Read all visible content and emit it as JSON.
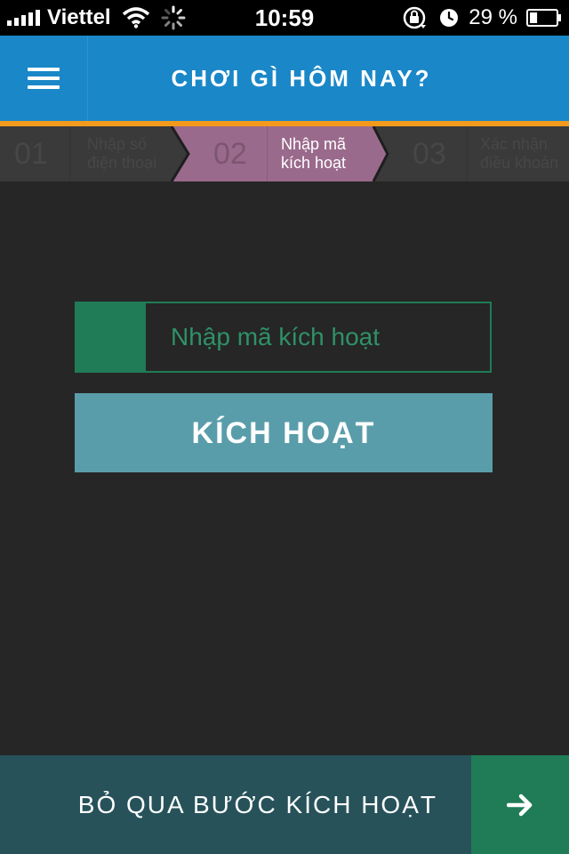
{
  "status_bar": {
    "carrier": "Viettel",
    "time": "10:59",
    "battery_percent": "29 %",
    "battery_level": 0.29
  },
  "header": {
    "title": "CHƠI GÌ HÔM NAY?",
    "menu_icon": "hamburger-menu-icon"
  },
  "steps": [
    {
      "number": "01",
      "label": "Nhập số\nđiện thoại",
      "active": false
    },
    {
      "number": "02",
      "label": "Nhập mã\nkích hoạt",
      "active": true
    },
    {
      "number": "03",
      "label": "Xác nhận\nđiều khoản",
      "active": false
    }
  ],
  "activation": {
    "placeholder": "Nhập mã kích hoạt",
    "value": "",
    "button_label": "KÍCH HOẠT"
  },
  "footer": {
    "skip_label": "BỎ QUA BƯỚC KÍCH HOẠT",
    "next_icon": "arrow-right-icon"
  },
  "colors": {
    "header_blue": "#1a87c8",
    "header_border_orange": "#f39a1d",
    "active_step": "#9a6a8c",
    "field_green": "#1f7c57",
    "button_teal": "#5a9daa",
    "footer_teal": "#27525a",
    "background": "#262626"
  }
}
